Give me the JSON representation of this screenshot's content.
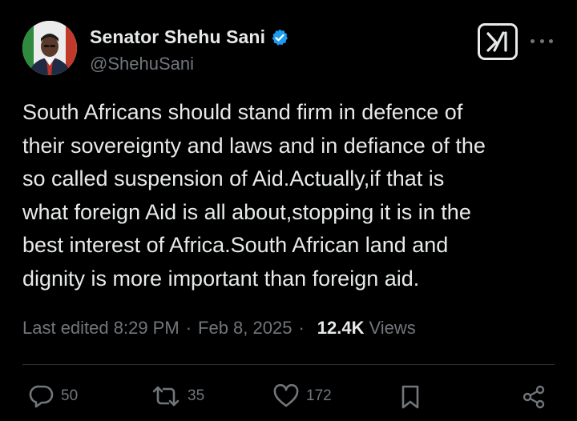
{
  "author": {
    "display_name": "Senator Shehu Sani",
    "handle": "@ShehuSani",
    "verified": true
  },
  "tweet": {
    "text": "South Africans should stand firm in defence of\ntheir sovereignty and laws and in defiance of the\nso called suspension of Aid.Actually,if that is\nwhat foreign Aid is all about,stopping it is in the\nbest interest of Africa.South African land and\ndignity is more important than foreign aid."
  },
  "meta": {
    "edited_label": "Last edited 8:29 PM",
    "date": "Feb 8, 2025",
    "separator": "·",
    "views_count": "12.4K",
    "views_label": "Views"
  },
  "actions": {
    "replies": "50",
    "reposts": "35",
    "likes": "172"
  },
  "icons": {
    "verified": "verified-badge-icon",
    "grok": "grok-icon",
    "more": "more-options-icon",
    "reply": "reply-icon",
    "repost": "repost-icon",
    "like": "heart-icon",
    "bookmark": "bookmark-icon",
    "share": "share-icon"
  },
  "colors": {
    "background": "#000000",
    "text_primary": "#e7e9ea",
    "text_secondary": "#71767b",
    "verified_blue": "#1d9bf0",
    "divider": "#2f3336"
  }
}
